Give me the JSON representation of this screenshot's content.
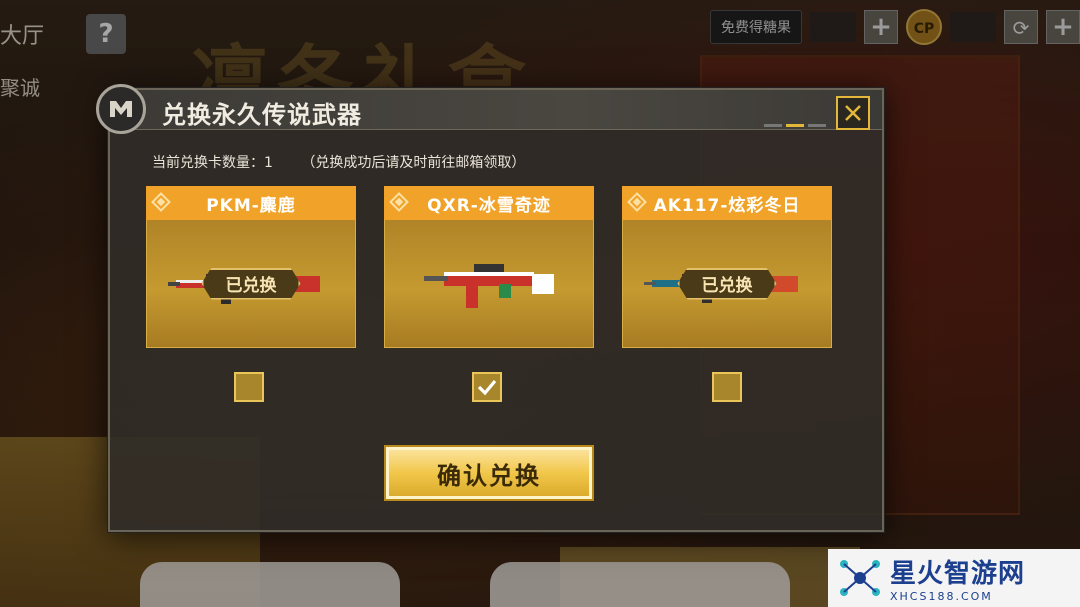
{
  "background": {
    "hall_label": "大厅",
    "juc_label": "聚诚",
    "help_label": "?",
    "banner_title": "凛冬礼盒"
  },
  "topbar": {
    "candy_button": "免费得糖果",
    "plus_1": "+",
    "cp_label": "CP",
    "refresh": "⟳",
    "plus_2": "+"
  },
  "modal": {
    "title": "兑换永久传说武器",
    "count_label": "当前兑换卡数量：1",
    "count_note": "（兑换成功后请及时前往邮箱领取）",
    "confirm_label": "确认兑换",
    "items": [
      {
        "name": "PKM-麋鹿",
        "status": "已兑换",
        "redeemed": true,
        "checked": false
      },
      {
        "name": "QXR-冰雪奇迹",
        "status": "",
        "redeemed": false,
        "checked": true
      },
      {
        "name": "AK117-炫彩冬日",
        "status": "已兑换",
        "redeemed": true,
        "checked": false
      }
    ]
  },
  "watermark": {
    "name": "星火智游网",
    "url": "XHCS188.COM"
  },
  "colors": {
    "accent": "#f1a329",
    "card_body": "#c59a30",
    "confirm": "#f1c74a",
    "border_gold": "#e3b83a"
  }
}
